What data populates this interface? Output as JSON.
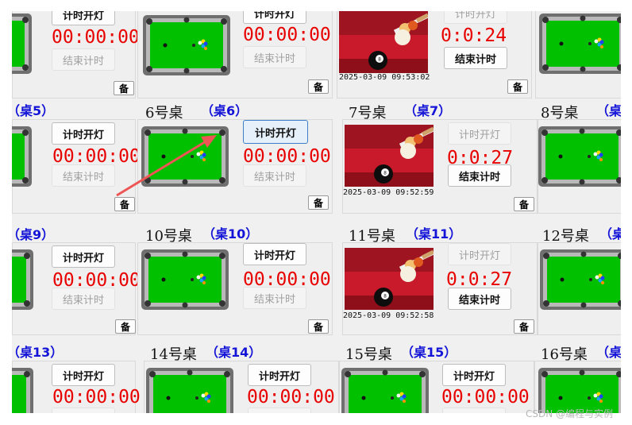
{
  "labels": {
    "start": "计时开灯",
    "stop": "结束计时",
    "reserve": "备"
  },
  "timers": {
    "zero": "00:00:00",
    "t_a": "0:0:24",
    "t_b": "0:0:27",
    "t_c": "0:0:27"
  },
  "stamps": {
    "a": "2025-03-09 09:53:02",
    "b": "2025-03-09 09:52:59",
    "c": "2025-03-09 09:52:58"
  },
  "tables": {
    "t6": "6号桌",
    "g6": "（桌6）",
    "t7": "7号桌",
    "g7": "（桌7）",
    "t8": "8号桌",
    "g8": "（桌",
    "g5": "（桌5）",
    "t10": "10号桌",
    "g10": "（桌10）",
    "t11": "11号桌",
    "g11": "（桌11）",
    "t12": "12号桌",
    "g12": "（桌",
    "g9": "（桌9）",
    "t14": "14号桌",
    "g14": "（桌14）",
    "t15": "15号桌",
    "g15": "（桌15）",
    "t16": "16号桌",
    "g16": "（桌",
    "g13": "（桌13）"
  },
  "colors": {
    "felt": "#00c000",
    "rail": "#6f6f6f",
    "timer": "#e80000",
    "tag": "#1414d8",
    "arrow": "#ee5555"
  },
  "watermark": "CSDN @编程与实例"
}
